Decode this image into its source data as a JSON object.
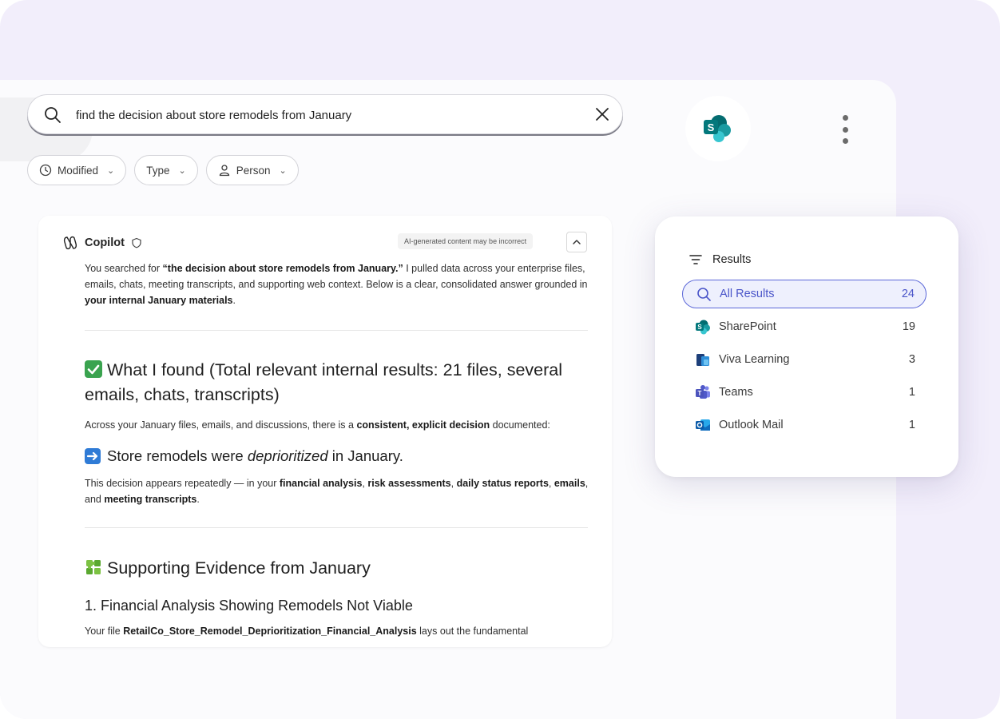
{
  "search": {
    "query": "find the decision about store remodels from January"
  },
  "filters": [
    {
      "label": "Modified",
      "icon": "clock-icon"
    },
    {
      "label": "Type",
      "icon": ""
    },
    {
      "label": "Person",
      "icon": "person-icon"
    }
  ],
  "copilot": {
    "title": "Copilot",
    "disclaimer": "AI-generated content may be incorrect",
    "intro_1": "You searched for ",
    "intro_bold_1": "“the decision about store remodels from January.”",
    "intro_2": " I pulled data across your enterprise files, emails, chats, meeting transcripts, and supporting web context. Below is a clear, consolidated answer grounded in ",
    "intro_bold_2": "your internal January materials",
    "intro_3": ".",
    "found_heading": "What I found (Total relevant internal results: 21 files, several emails, chats, transcripts)",
    "found_p1": "Across your January files, emails, and discussions, there is a ",
    "found_bold_1": "consistent, explicit decision",
    "found_p2": " documented:",
    "decision_pre": "Store remodels were ",
    "decision_em": "deprioritized",
    "decision_post": " in January.",
    "appears_1": "This decision appears repeatedly — in your ",
    "appears_b1": "financial analysis",
    "appears_s1": ", ",
    "appears_b2": "risk assessments",
    "appears_s2": ", ",
    "appears_b3": "daily status reports",
    "appears_s3": ", ",
    "appears_b4": "emails",
    "appears_s4": ", and ",
    "appears_b5": "meeting transcripts",
    "appears_end": ".",
    "evidence_heading": "Supporting Evidence from January",
    "sub_heading": "1. Financial Analysis Showing Remodels Not Viable",
    "file_pre": "Your file ",
    "file_name": "RetailCo_Store_Remodel_Deprioritization_Financial_Analysis",
    "file_post": " lays out the fundamental"
  },
  "results_panel": {
    "title": "Results",
    "items": [
      {
        "label": "All Results",
        "count": "24",
        "icon": "search-icon"
      },
      {
        "label": "SharePoint",
        "count": "19",
        "icon": "sharepoint-icon"
      },
      {
        "label": "Viva Learning",
        "count": "3",
        "icon": "viva-learning-icon"
      },
      {
        "label": "Teams",
        "count": "1",
        "icon": "teams-icon"
      },
      {
        "label": "Outlook Mail",
        "count": "1",
        "icon": "outlook-icon"
      }
    ]
  },
  "colors": {
    "background": "#f2eefb",
    "accent": "#5b67d8",
    "sharepoint": "#036c70",
    "teams": "#5059c9",
    "outlook": "#0f6cbd"
  }
}
